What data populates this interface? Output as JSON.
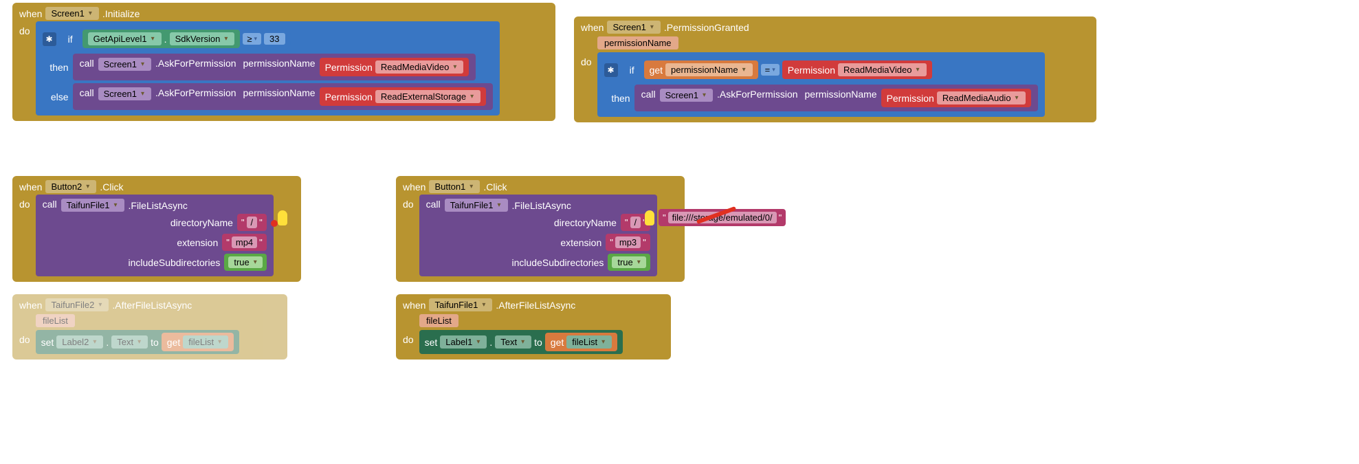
{
  "init": {
    "when": "when",
    "screen": "Screen1",
    "event": ".Initialize",
    "do": "do",
    "if": "if",
    "then": "then",
    "else": "else",
    "apiLevel": "GetApiLevel1",
    "sdkVersion": "SdkVersion",
    "ge": "≥",
    "num33": "33",
    "call": "call",
    "askFor": ".AskForPermission",
    "permName": "permissionName",
    "permission": "Permission",
    "readMediaVideo": "ReadMediaVideo",
    "readExternalStorage": "ReadExternalStorage"
  },
  "granted": {
    "when": "when",
    "screen": "Screen1",
    "event": ".PermissionGranted",
    "param": "permissionName",
    "do": "do",
    "if": "if",
    "then": "then",
    "get": "get",
    "permName": "permissionName",
    "eq": "=",
    "permission": "Permission",
    "readMediaVideo": "ReadMediaVideo",
    "call": "call",
    "askFor": ".AskForPermission",
    "readMediaAudio": "ReadMediaAudio"
  },
  "btn2": {
    "when": "when",
    "button": "Button2",
    "event": ".Click",
    "do": "do",
    "call": "call",
    "file": "TaifunFile1",
    "method": ".FileListAsync",
    "dirName": "directoryName",
    "ext": "extension",
    "incSub": "includeSubdirectories",
    "slash": "/",
    "mp4": "mp4",
    "true": "true"
  },
  "btn1": {
    "when": "when",
    "button": "Button1",
    "event": ".Click",
    "do": "do",
    "call": "call",
    "file": "TaifunFile1",
    "method": ".FileListAsync",
    "dirName": "directoryName",
    "ext": "extension",
    "incSub": "includeSubdirectories",
    "slash": "/",
    "mp3": "mp3",
    "true": "true",
    "detached": "file:///storage/emulated/0/"
  },
  "after2": {
    "when": "when",
    "file": "TaifunFile2",
    "event": ".AfterFileListAsync",
    "param": "fileList",
    "do": "do",
    "set": "set",
    "label": "Label2",
    "text": "Text",
    "to": "to",
    "get": "get",
    "fileList": "fileList"
  },
  "after1": {
    "when": "when",
    "file": "TaifunFile1",
    "event": ".AfterFileListAsync",
    "param": "fileList",
    "do": "do",
    "set": "set",
    "label": "Label1",
    "text": "Text",
    "to": "to",
    "get": "get",
    "fileList": "fileList"
  }
}
